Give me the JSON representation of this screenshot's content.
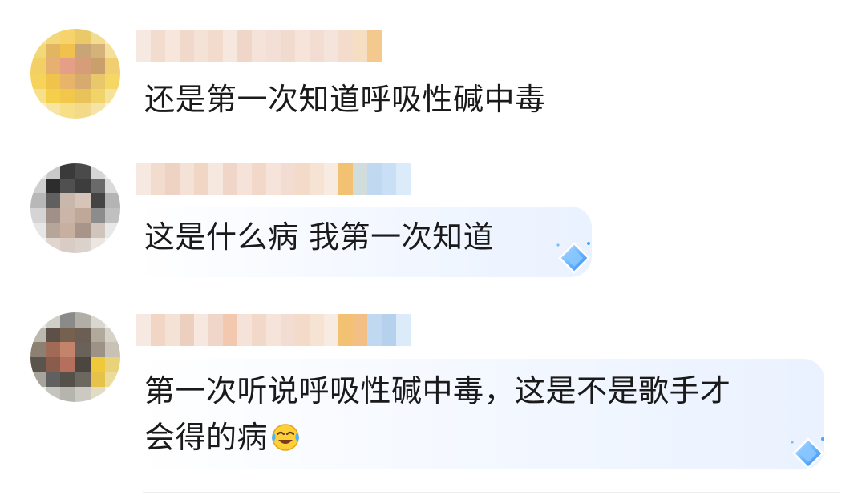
{
  "comments": [
    {
      "text": "还是第一次知道呼吸性碱中毒",
      "has_badge": false
    },
    {
      "text": "这是什么病 我第一次知道",
      "has_badge": true
    },
    {
      "text_line1": "第一次听说呼吸性碱中毒，这是不是歌手才",
      "text_line2": "会得的病",
      "emoji": "laughing-crying-emoji",
      "has_badge": true
    }
  ],
  "colors": {
    "bubble_tint": "#eaf2ff",
    "gem_blue": "#4fa3f7",
    "text": "#1a1a1a"
  }
}
